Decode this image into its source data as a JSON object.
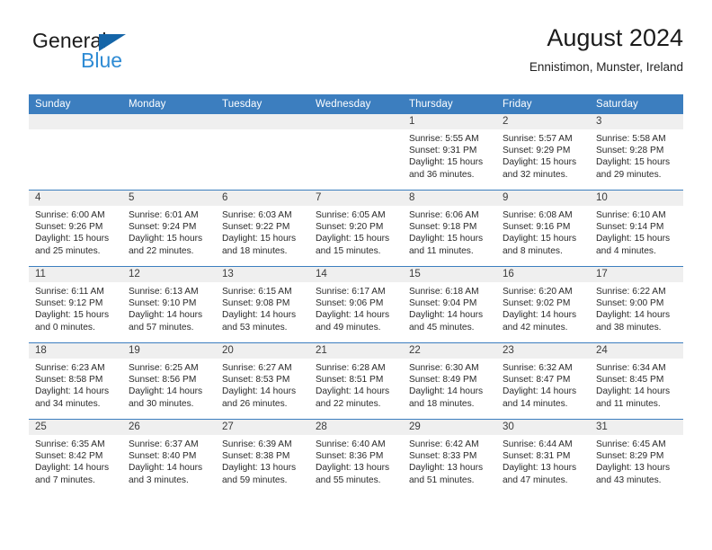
{
  "brand": {
    "name_top": "General",
    "name_bottom": "Blue",
    "accent_color": "#2e8bd4",
    "triangle_color": "#1565a8"
  },
  "header": {
    "month_title": "August 2024",
    "location": "Ennistimon, Munster, Ireland"
  },
  "theme": {
    "header_blue": "#3c7ebf",
    "band_gray": "#efefef",
    "text_color": "#2a2a2a"
  },
  "weekdays": [
    "Sunday",
    "Monday",
    "Tuesday",
    "Wednesday",
    "Thursday",
    "Friday",
    "Saturday"
  ],
  "weeks": [
    [
      {
        "day": "",
        "lines": []
      },
      {
        "day": "",
        "lines": []
      },
      {
        "day": "",
        "lines": []
      },
      {
        "day": "",
        "lines": []
      },
      {
        "day": "1",
        "lines": [
          "Sunrise: 5:55 AM",
          "Sunset: 9:31 PM",
          "Daylight: 15 hours",
          "and 36 minutes."
        ]
      },
      {
        "day": "2",
        "lines": [
          "Sunrise: 5:57 AM",
          "Sunset: 9:29 PM",
          "Daylight: 15 hours",
          "and 32 minutes."
        ]
      },
      {
        "day": "3",
        "lines": [
          "Sunrise: 5:58 AM",
          "Sunset: 9:28 PM",
          "Daylight: 15 hours",
          "and 29 minutes."
        ]
      }
    ],
    [
      {
        "day": "4",
        "lines": [
          "Sunrise: 6:00 AM",
          "Sunset: 9:26 PM",
          "Daylight: 15 hours",
          "and 25 minutes."
        ]
      },
      {
        "day": "5",
        "lines": [
          "Sunrise: 6:01 AM",
          "Sunset: 9:24 PM",
          "Daylight: 15 hours",
          "and 22 minutes."
        ]
      },
      {
        "day": "6",
        "lines": [
          "Sunrise: 6:03 AM",
          "Sunset: 9:22 PM",
          "Daylight: 15 hours",
          "and 18 minutes."
        ]
      },
      {
        "day": "7",
        "lines": [
          "Sunrise: 6:05 AM",
          "Sunset: 9:20 PM",
          "Daylight: 15 hours",
          "and 15 minutes."
        ]
      },
      {
        "day": "8",
        "lines": [
          "Sunrise: 6:06 AM",
          "Sunset: 9:18 PM",
          "Daylight: 15 hours",
          "and 11 minutes."
        ]
      },
      {
        "day": "9",
        "lines": [
          "Sunrise: 6:08 AM",
          "Sunset: 9:16 PM",
          "Daylight: 15 hours",
          "and 8 minutes."
        ]
      },
      {
        "day": "10",
        "lines": [
          "Sunrise: 6:10 AM",
          "Sunset: 9:14 PM",
          "Daylight: 15 hours",
          "and 4 minutes."
        ]
      }
    ],
    [
      {
        "day": "11",
        "lines": [
          "Sunrise: 6:11 AM",
          "Sunset: 9:12 PM",
          "Daylight: 15 hours",
          "and 0 minutes."
        ]
      },
      {
        "day": "12",
        "lines": [
          "Sunrise: 6:13 AM",
          "Sunset: 9:10 PM",
          "Daylight: 14 hours",
          "and 57 minutes."
        ]
      },
      {
        "day": "13",
        "lines": [
          "Sunrise: 6:15 AM",
          "Sunset: 9:08 PM",
          "Daylight: 14 hours",
          "and 53 minutes."
        ]
      },
      {
        "day": "14",
        "lines": [
          "Sunrise: 6:17 AM",
          "Sunset: 9:06 PM",
          "Daylight: 14 hours",
          "and 49 minutes."
        ]
      },
      {
        "day": "15",
        "lines": [
          "Sunrise: 6:18 AM",
          "Sunset: 9:04 PM",
          "Daylight: 14 hours",
          "and 45 minutes."
        ]
      },
      {
        "day": "16",
        "lines": [
          "Sunrise: 6:20 AM",
          "Sunset: 9:02 PM",
          "Daylight: 14 hours",
          "and 42 minutes."
        ]
      },
      {
        "day": "17",
        "lines": [
          "Sunrise: 6:22 AM",
          "Sunset: 9:00 PM",
          "Daylight: 14 hours",
          "and 38 minutes."
        ]
      }
    ],
    [
      {
        "day": "18",
        "lines": [
          "Sunrise: 6:23 AM",
          "Sunset: 8:58 PM",
          "Daylight: 14 hours",
          "and 34 minutes."
        ]
      },
      {
        "day": "19",
        "lines": [
          "Sunrise: 6:25 AM",
          "Sunset: 8:56 PM",
          "Daylight: 14 hours",
          "and 30 minutes."
        ]
      },
      {
        "day": "20",
        "lines": [
          "Sunrise: 6:27 AM",
          "Sunset: 8:53 PM",
          "Daylight: 14 hours",
          "and 26 minutes."
        ]
      },
      {
        "day": "21",
        "lines": [
          "Sunrise: 6:28 AM",
          "Sunset: 8:51 PM",
          "Daylight: 14 hours",
          "and 22 minutes."
        ]
      },
      {
        "day": "22",
        "lines": [
          "Sunrise: 6:30 AM",
          "Sunset: 8:49 PM",
          "Daylight: 14 hours",
          "and 18 minutes."
        ]
      },
      {
        "day": "23",
        "lines": [
          "Sunrise: 6:32 AM",
          "Sunset: 8:47 PM",
          "Daylight: 14 hours",
          "and 14 minutes."
        ]
      },
      {
        "day": "24",
        "lines": [
          "Sunrise: 6:34 AM",
          "Sunset: 8:45 PM",
          "Daylight: 14 hours",
          "and 11 minutes."
        ]
      }
    ],
    [
      {
        "day": "25",
        "lines": [
          "Sunrise: 6:35 AM",
          "Sunset: 8:42 PM",
          "Daylight: 14 hours",
          "and 7 minutes."
        ]
      },
      {
        "day": "26",
        "lines": [
          "Sunrise: 6:37 AM",
          "Sunset: 8:40 PM",
          "Daylight: 14 hours",
          "and 3 minutes."
        ]
      },
      {
        "day": "27",
        "lines": [
          "Sunrise: 6:39 AM",
          "Sunset: 8:38 PM",
          "Daylight: 13 hours",
          "and 59 minutes."
        ]
      },
      {
        "day": "28",
        "lines": [
          "Sunrise: 6:40 AM",
          "Sunset: 8:36 PM",
          "Daylight: 13 hours",
          "and 55 minutes."
        ]
      },
      {
        "day": "29",
        "lines": [
          "Sunrise: 6:42 AM",
          "Sunset: 8:33 PM",
          "Daylight: 13 hours",
          "and 51 minutes."
        ]
      },
      {
        "day": "30",
        "lines": [
          "Sunrise: 6:44 AM",
          "Sunset: 8:31 PM",
          "Daylight: 13 hours",
          "and 47 minutes."
        ]
      },
      {
        "day": "31",
        "lines": [
          "Sunrise: 6:45 AM",
          "Sunset: 8:29 PM",
          "Daylight: 13 hours",
          "and 43 minutes."
        ]
      }
    ]
  ]
}
